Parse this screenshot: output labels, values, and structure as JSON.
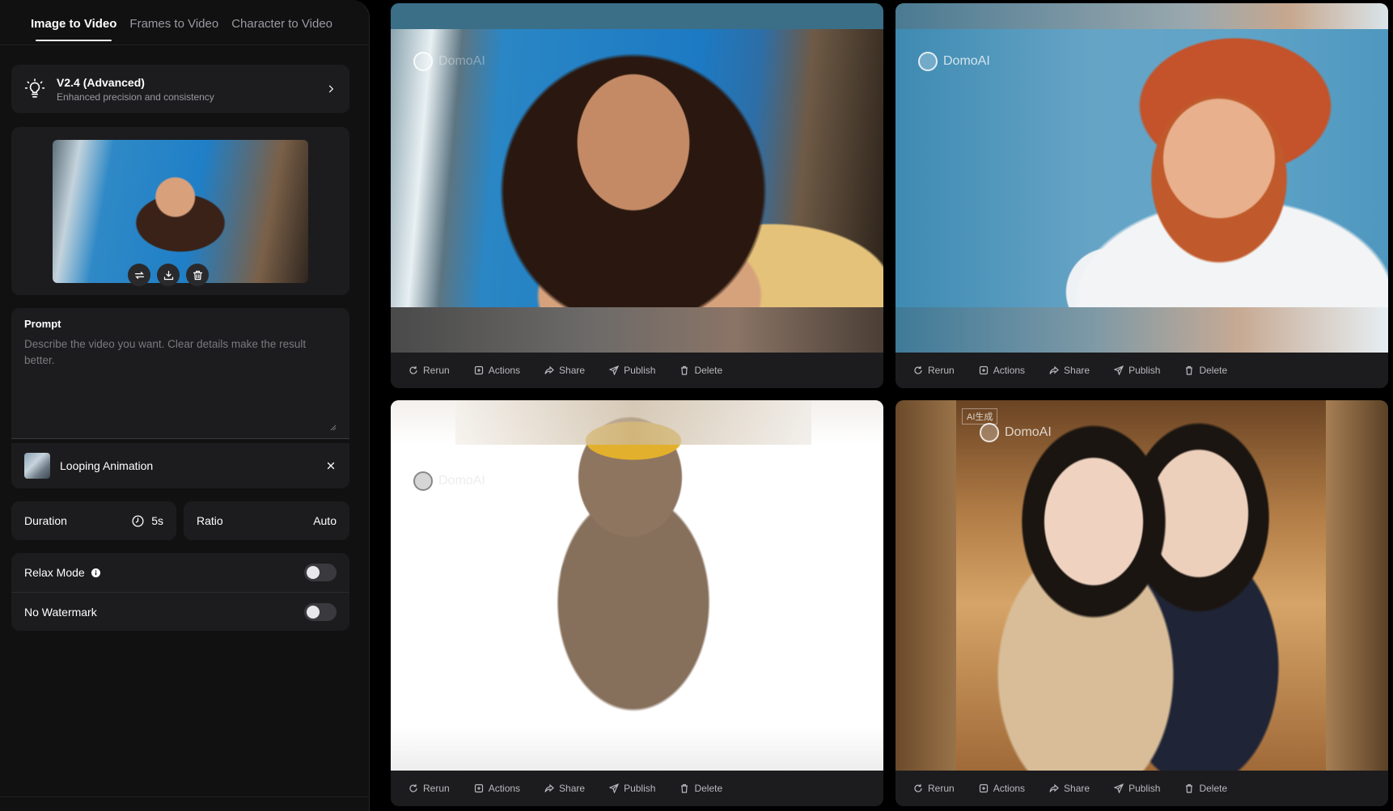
{
  "tabs": [
    {
      "label": "Image to Video",
      "active": true
    },
    {
      "label": "Frames to Video",
      "active": false
    },
    {
      "label": "Character to Video",
      "active": false
    }
  ],
  "model": {
    "name": "V2.4 (Advanced)",
    "description": "Enhanced precision and consistency",
    "icon": "lightbulb-icon"
  },
  "upload": {
    "tools": [
      "swap-icon",
      "download-icon",
      "trash-icon"
    ]
  },
  "prompt": {
    "label": "Prompt",
    "value": "",
    "placeholder": "Describe the video you want. Clear details make the result better."
  },
  "template": {
    "label": "Looping Animation"
  },
  "duration": {
    "label": "Duration",
    "value": "5s"
  },
  "ratio": {
    "label": "Ratio",
    "value": "Auto"
  },
  "toggles": [
    {
      "label": "Relax Mode",
      "on": false,
      "has_info": true
    },
    {
      "label": "No Watermark",
      "on": false,
      "has_info": false
    }
  ],
  "actions": [
    "Rerun",
    "Actions",
    "Share",
    "Publish",
    "Delete"
  ],
  "videos": [
    {
      "watermark": "DomoAI"
    },
    {
      "watermark": "DomoAI"
    },
    {
      "watermark": "DomoAI"
    },
    {
      "watermark": "DomoAI",
      "badge": "AI生成"
    }
  ],
  "colors": {
    "background": "#000000",
    "panel": "#1c1c1e",
    "text": "#ffffff",
    "muted": "#9a9aa0"
  }
}
